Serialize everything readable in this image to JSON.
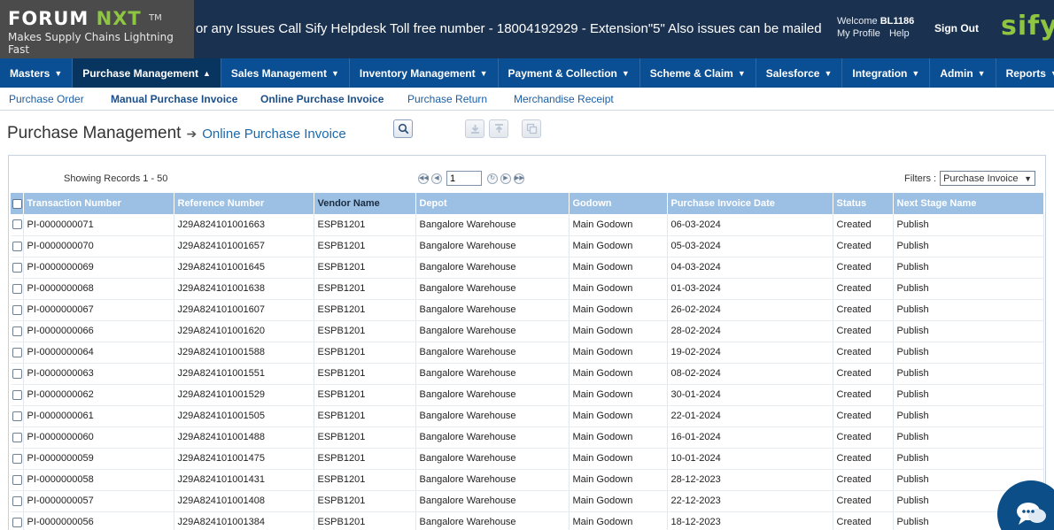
{
  "header": {
    "logo_main": "FORUM",
    "logo_accent": "NXT",
    "logo_tm": "TM",
    "tagline": "Makes Supply Chains Lightning Fast",
    "marquee": "or any Issues Call Sify Helpdesk Toll free number - 18004192929 - Extension\"5\" Also issues can be mailed",
    "welcome_label": "Welcome",
    "user": "BL1186",
    "my_profile": "My Profile",
    "help": "Help",
    "sign_out": "Sign Out",
    "brand": "sify"
  },
  "main_nav": [
    {
      "label": "Masters",
      "caret": "▼"
    },
    {
      "label": "Purchase Management",
      "caret": "▲"
    },
    {
      "label": "Sales Management",
      "caret": "▼"
    },
    {
      "label": "Inventory Management",
      "caret": "▼"
    },
    {
      "label": "Payment & Collection",
      "caret": "▼"
    },
    {
      "label": "Scheme & Claim",
      "caret": "▼"
    },
    {
      "label": "Salesforce",
      "caret": "▼"
    },
    {
      "label": "Integration",
      "caret": "▼"
    },
    {
      "label": "Admin",
      "caret": "▼"
    },
    {
      "label": "Reports",
      "caret": "▼"
    }
  ],
  "sub_nav": [
    {
      "label": "Purchase Order"
    },
    {
      "label": "Manual Purchase Invoice"
    },
    {
      "label": "Online Purchase Invoice"
    },
    {
      "label": "Purchase Return"
    },
    {
      "label": "Merchandise Receipt"
    }
  ],
  "page": {
    "title": "Purchase Management",
    "breadcrumb_arrow": "➔",
    "breadcrumb": "Online Purchase Invoice"
  },
  "grid": {
    "showing": "Showing Records 1 - 50",
    "page_value": "1",
    "filters_label": "Filters :",
    "filter_value": "Purchase Invoice",
    "columns": [
      "Transaction Number",
      "Reference Number",
      "Vendor Name",
      "Depot",
      "Godown",
      "Purchase Invoice Date",
      "Status",
      "Next Stage Name"
    ],
    "rows": [
      [
        "PI-0000000071",
        "J29A824101001663",
        "ESPB1201",
        "Bangalore Warehouse",
        "Main Godown",
        "06-03-2024",
        "Created",
        "Publish"
      ],
      [
        "PI-0000000070",
        "J29A824101001657",
        "ESPB1201",
        "Bangalore Warehouse",
        "Main Godown",
        "05-03-2024",
        "Created",
        "Publish"
      ],
      [
        "PI-0000000069",
        "J29A824101001645",
        "ESPB1201",
        "Bangalore Warehouse",
        "Main Godown",
        "04-03-2024",
        "Created",
        "Publish"
      ],
      [
        "PI-0000000068",
        "J29A824101001638",
        "ESPB1201",
        "Bangalore Warehouse",
        "Main Godown",
        "01-03-2024",
        "Created",
        "Publish"
      ],
      [
        "PI-0000000067",
        "J29A824101001607",
        "ESPB1201",
        "Bangalore Warehouse",
        "Main Godown",
        "26-02-2024",
        "Created",
        "Publish"
      ],
      [
        "PI-0000000066",
        "J29A824101001620",
        "ESPB1201",
        "Bangalore Warehouse",
        "Main Godown",
        "28-02-2024",
        "Created",
        "Publish"
      ],
      [
        "PI-0000000064",
        "J29A824101001588",
        "ESPB1201",
        "Bangalore Warehouse",
        "Main Godown",
        "19-02-2024",
        "Created",
        "Publish"
      ],
      [
        "PI-0000000063",
        "J29A824101001551",
        "ESPB1201",
        "Bangalore Warehouse",
        "Main Godown",
        "08-02-2024",
        "Created",
        "Publish"
      ],
      [
        "PI-0000000062",
        "J29A824101001529",
        "ESPB1201",
        "Bangalore Warehouse",
        "Main Godown",
        "30-01-2024",
        "Created",
        "Publish"
      ],
      [
        "PI-0000000061",
        "J29A824101001505",
        "ESPB1201",
        "Bangalore Warehouse",
        "Main Godown",
        "22-01-2024",
        "Created",
        "Publish"
      ],
      [
        "PI-0000000060",
        "J29A824101001488",
        "ESPB1201",
        "Bangalore Warehouse",
        "Main Godown",
        "16-01-2024",
        "Created",
        "Publish"
      ],
      [
        "PI-0000000059",
        "J29A824101001475",
        "ESPB1201",
        "Bangalore Warehouse",
        "Main Godown",
        "10-01-2024",
        "Created",
        "Publish"
      ],
      [
        "PI-0000000058",
        "J29A824101001431",
        "ESPB1201",
        "Bangalore Warehouse",
        "Main Godown",
        "28-12-2023",
        "Created",
        "Publish"
      ],
      [
        "PI-0000000057",
        "J29A824101001408",
        "ESPB1201",
        "Bangalore Warehouse",
        "Main Godown",
        "22-12-2023",
        "Created",
        "Publish"
      ],
      [
        "PI-0000000056",
        "J29A824101001384",
        "ESPB1201",
        "Bangalore Warehouse",
        "Main Godown",
        "18-12-2023",
        "Created",
        "Publish"
      ]
    ]
  },
  "icons": {
    "search": "search-icon",
    "download": "download-icon",
    "upload": "upload-icon",
    "copy": "copy-icon",
    "chat": "chat-icon"
  }
}
